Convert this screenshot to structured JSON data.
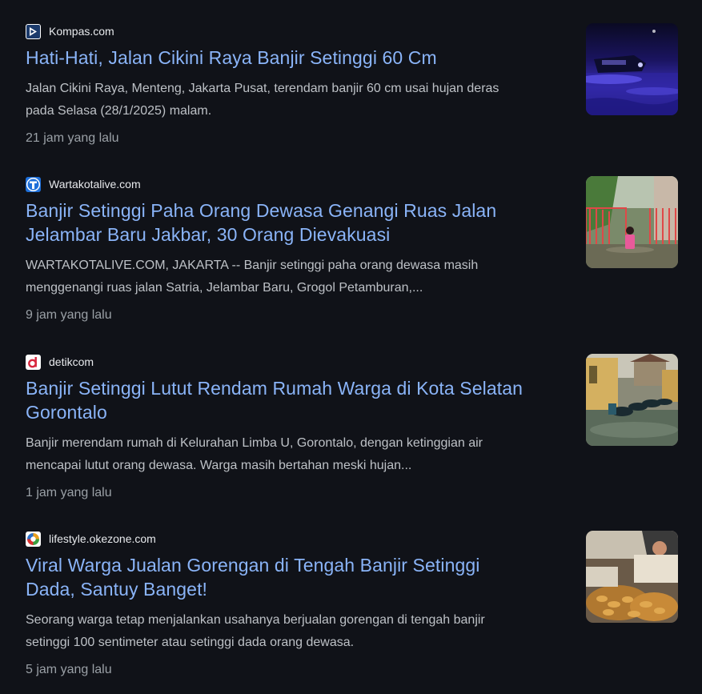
{
  "results": [
    {
      "source": "Kompas.com",
      "favicon_icon": "kompas-logo-icon",
      "title": "Hati-Hati, Jalan Cikini Raya Banjir Setinggi 60 Cm",
      "snippet_lines": [
        "Jalan Cikini Raya, Menteng, Jakarta Pusat, terendam banjir 60 cm usai hujan deras",
        "pada Selasa (28/1/2025) malam."
      ],
      "time": "21 jam yang lalu",
      "thumbnail_icon": "flooded-street-night-image"
    },
    {
      "source": "Wartakotalive.com",
      "favicon_icon": "wartakota-logo-icon",
      "title_lines": [
        "Banjir Setinggi Paha Orang Dewasa Genangi Ruas Jalan",
        "Jelambar Baru Jakbar, 30 Orang Dievakuasi"
      ],
      "snippet_lines": [
        "WARTAKOTALIVE.COM, JAKARTA -- Banjir setinggi paha orang dewasa masih",
        "menggenangi ruas jalan Satria, Jelambar Baru, Grogol Petamburan,..."
      ],
      "time": "9 jam yang lalu",
      "thumbnail_icon": "flooded-alley-image"
    },
    {
      "source": "detikcom",
      "favicon_icon": "detik-logo-icon",
      "title_lines": [
        "Banjir Setinggi Lutut Rendam Rumah Warga di Kota Selatan",
        "Gorontalo"
      ],
      "snippet_lines": [
        "Banjir merendam rumah di Kelurahan Limba U, Gorontalo, dengan ketinggian air",
        "mencapai lutut orang dewasa. Warga masih bertahan meski hujan..."
      ],
      "time": "1 jam yang lalu",
      "thumbnail_icon": "flooded-motorbikes-image"
    },
    {
      "source": "lifestyle.okezone.com",
      "favicon_icon": "okezone-logo-icon",
      "title_lines": [
        "Viral Warga Jualan Gorengan di Tengah Banjir Setinggi",
        "Dada, Santuy Banget!"
      ],
      "snippet_lines": [
        "Seorang warga tetap menjalankan usahanya berjualan gorengan di tengah banjir",
        "setinggi 100 sentimeter atau setinggi dada orang dewasa."
      ],
      "time": "5 jam yang lalu",
      "thumbnail_icon": "fried-snacks-image"
    }
  ],
  "colors": {
    "background": "#101218",
    "title_link": "#8ab4f8",
    "snippet_text": "#bdc1c6",
    "source_text": "#e8eaed",
    "time_text": "#9aa0a6"
  }
}
